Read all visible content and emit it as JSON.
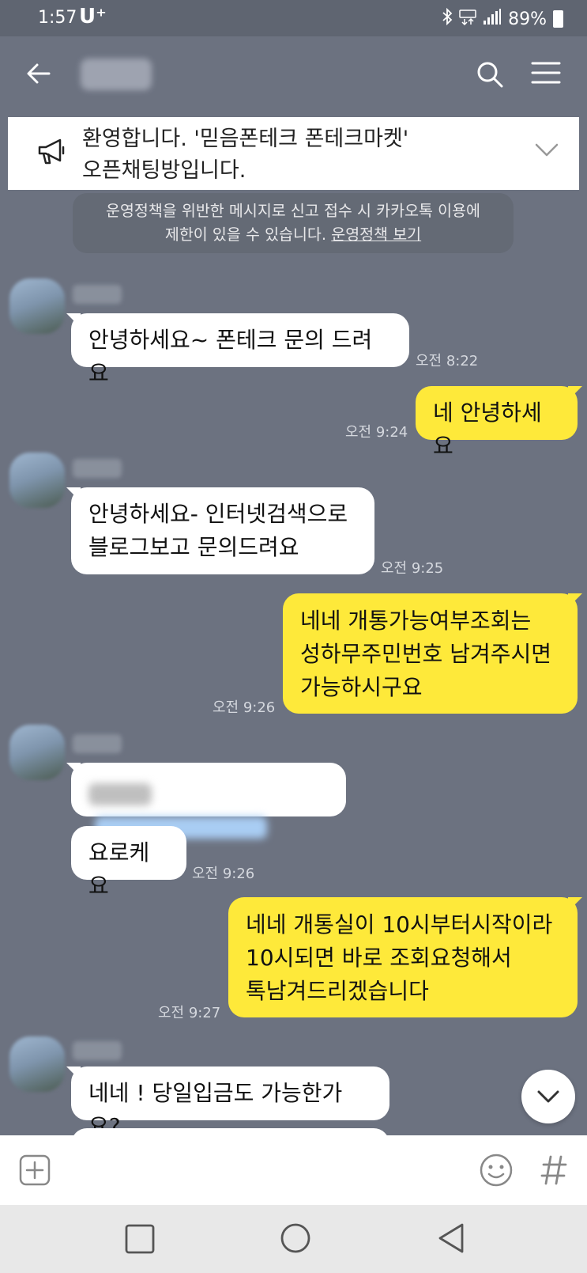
{
  "status_bar": {
    "time": "1:57",
    "carrier": "U⁺",
    "battery": "89%"
  },
  "header": {
    "title": ""
  },
  "notice": {
    "line1": "환영합니다. '믿음폰테크 폰테크마켓'",
    "line2": "오픈채팅방입니다."
  },
  "policy": {
    "line1": "운영정책을 위반한 메시지로 신고 접수 시 카카오톡 이용에",
    "line2_prefix": "제한이 있을 수 있습니다. ",
    "link": "운영정책 보기"
  },
  "messages": [
    {
      "dir": "in",
      "lines": [
        "안녕하세요~ 폰테크 문의 드려요"
      ],
      "time": "오전 8:22"
    },
    {
      "dir": "out",
      "lines": [
        "네 안녕하세요"
      ],
      "time": "오전 9:24"
    },
    {
      "dir": "in",
      "lines": [
        "안녕하세요- 인터넷검색으로",
        "블로그보고 문의드려요"
      ],
      "time": "오전 9:25"
    },
    {
      "dir": "out",
      "lines": [
        "네네 개통가능여부조회는",
        "성하무주민번호 남겨주시면",
        "가능하시구요"
      ],
      "time": "오전 9:26"
    },
    {
      "dir": "in",
      "lines": [
        "요로케요"
      ],
      "time": "오전 9:26"
    },
    {
      "dir": "out",
      "lines": [
        "네네 개통실이 10시부터시작이라",
        "10시되면 바로 조회요청해서",
        "톡남겨드리겠습니다"
      ],
      "time": "오전 9:27"
    },
    {
      "dir": "in",
      "lines": [
        "네네 ! 당일입금도 가능한가요?"
      ],
      "time": ""
    }
  ],
  "input_bar": {
    "placeholder": ""
  },
  "colors": {
    "background": "#6c7280",
    "outgoing": "#fee93a",
    "incoming": "#ffffff"
  },
  "icons": [
    "back-arrow-icon",
    "search-icon",
    "menu-icon",
    "megaphone-icon",
    "chevron-down-icon",
    "plus-icon",
    "emoji-icon",
    "hashtag-icon",
    "recent-apps-icon",
    "home-icon",
    "back-icon"
  ]
}
